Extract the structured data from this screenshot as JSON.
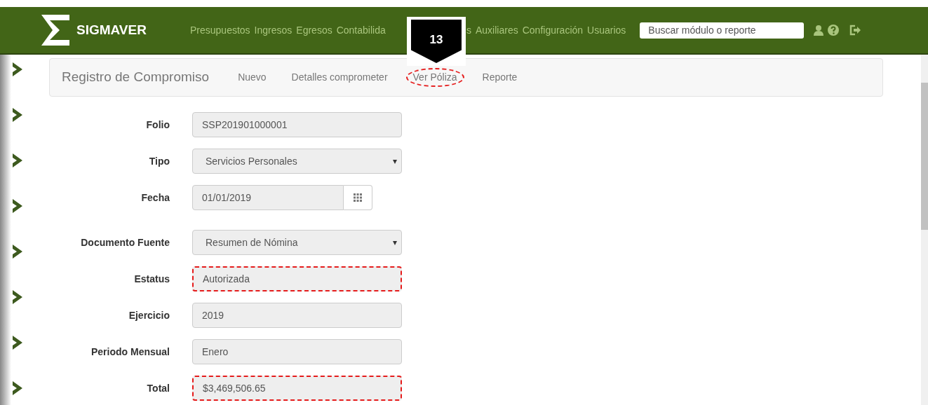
{
  "header": {
    "brand": "SIGMAVER",
    "nav": [
      {
        "label": "Presupuestos"
      },
      {
        "label": "Ingresos"
      },
      {
        "label": "Egresos"
      },
      {
        "label": "Contabilida"
      },
      {
        "label": "s"
      },
      {
        "label": "Auxiliares"
      },
      {
        "label": "Configuración"
      },
      {
        "label": "Usuarios"
      }
    ],
    "search": {
      "placeholder": "Buscar módulo o reporte"
    }
  },
  "callout": {
    "number": "13"
  },
  "subnav": {
    "title": "Registro de Compromiso",
    "links": [
      {
        "label": "Nuevo",
        "highlighted": false
      },
      {
        "label": "Detalles comprometer",
        "highlighted": false
      },
      {
        "label": "Ver Póliza",
        "highlighted": true
      },
      {
        "label": "Reporte",
        "highlighted": false
      }
    ]
  },
  "form": [
    {
      "label": "Folio",
      "kind": "text",
      "value": "SSP201901000001",
      "highlighted": false
    },
    {
      "label": "Tipo",
      "kind": "select",
      "value": "Servicios Personales",
      "caret": "▾",
      "highlighted": false
    },
    {
      "label": "Fecha",
      "kind": "date",
      "value": "01/01/2019",
      "highlighted": false
    },
    {
      "label": "Documento Fuente",
      "kind": "select",
      "value": "Resumen de Nómina",
      "caret": "▾",
      "highlighted": false
    },
    {
      "label": "Estatus",
      "kind": "text",
      "value": "Autorizada",
      "highlighted": true
    },
    {
      "label": "Ejercicio",
      "kind": "text",
      "value": "2019",
      "highlighted": false
    },
    {
      "label": "Periodo Mensual",
      "kind": "text",
      "value": "Enero",
      "highlighted": false
    },
    {
      "label": "Total",
      "kind": "text",
      "value": "$3,469,506.65",
      "highlighted": true
    }
  ]
}
